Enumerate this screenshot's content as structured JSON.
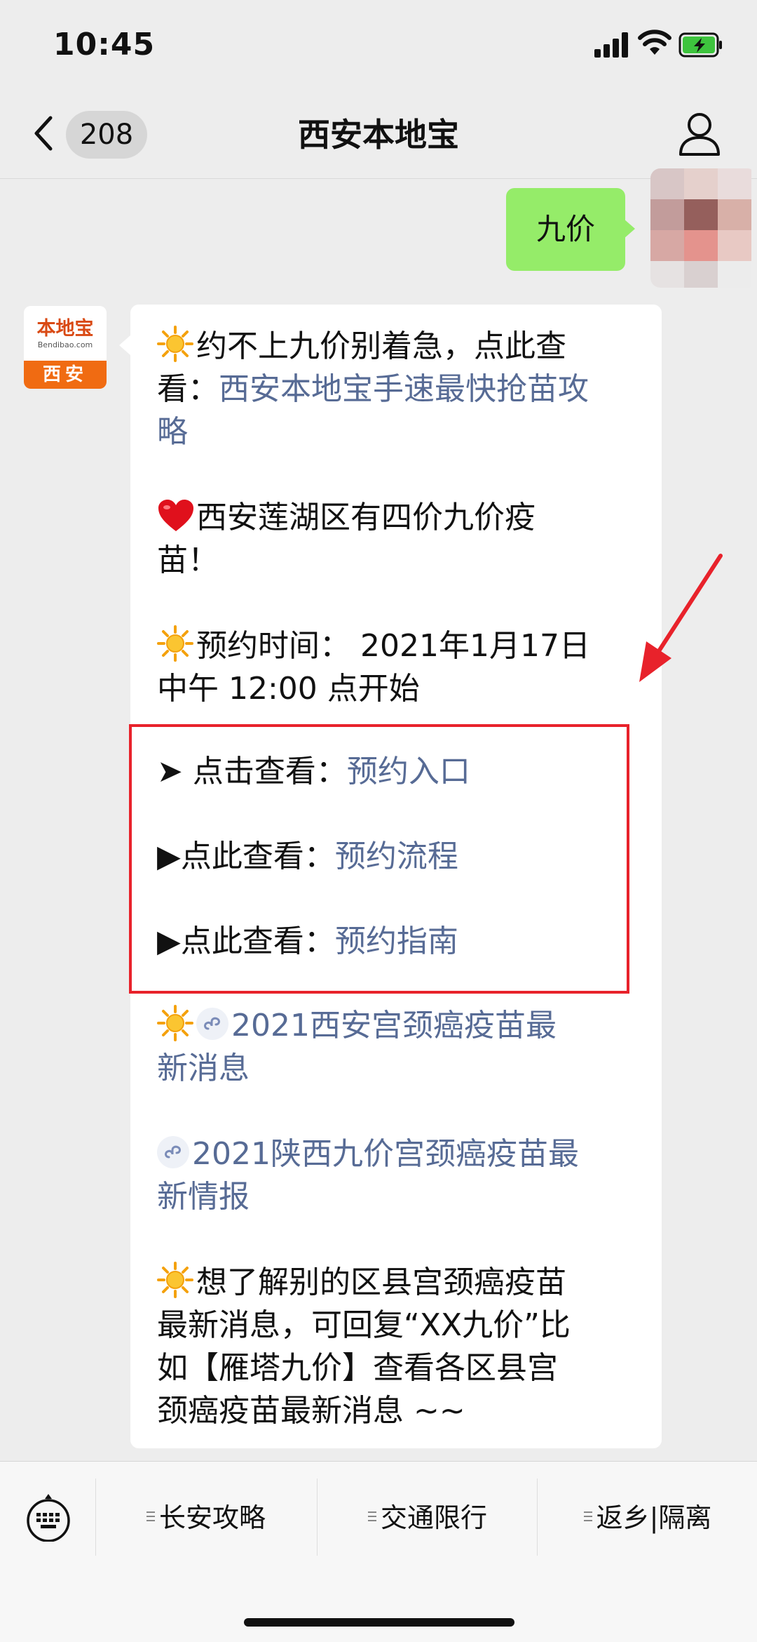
{
  "status_bar": {
    "time": "10:45"
  },
  "nav": {
    "unread_count": "208",
    "title": "西安本地宝"
  },
  "my_message": {
    "text": "九价"
  },
  "brand_avatar": {
    "name_cn": "本地宝",
    "domain": "Bendibao.com",
    "city": "西安"
  },
  "reply": {
    "block1_text": "约不上九价别着急，点此查",
    "block1_text2": "看：",
    "block1_link": "西安本地宝手速最快抢苗攻",
    "block1_link2": "略",
    "block2_line1": "西安莲湖区有四价九价疫",
    "block2_line2": "苗！",
    "block3_line1": "预约时间： 2021年1月17日",
    "block3_line2": "中午 12:00 点开始",
    "entry1_prefix": "➤ 点击查看：",
    "entry1_link": "预约入口",
    "entry2_prefix": "▶点此查看：",
    "entry2_link": "预约流程",
    "entry3_prefix": "▶点此查看：",
    "entry3_link": "预约指南",
    "mini1_line1": "2021西安宫颈癌疫苗最",
    "mini1_line2": "新消息",
    "mini2_line1": "2021陕西九价宫颈癌疫苗最",
    "mini2_line2": "新情报",
    "block6_line1": "想了解别的区县宫颈癌疫苗",
    "block6_line2": "最新消息，可回复“XX九价”比",
    "block6_line3": "如【雁塔九价】查看各区县宫",
    "block6_line4": "颈癌疫苗最新消息 ~~"
  },
  "menu": {
    "items": [
      {
        "label": "长安攻略"
      },
      {
        "label": "交通限行"
      },
      {
        "label": "返乡|隔离"
      }
    ]
  },
  "colors": {
    "link": "#576b95",
    "my_bubble": "#95ec69",
    "highlight_box": "#e8222b",
    "brand": "#f06b12"
  }
}
